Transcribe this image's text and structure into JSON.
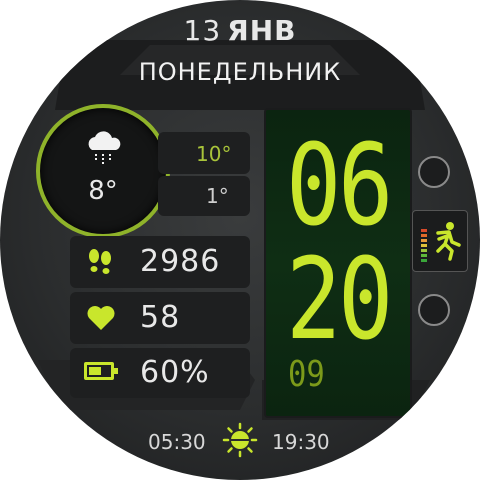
{
  "date": {
    "day": "13",
    "month": "ЯНВ"
  },
  "weekday": "ПОНЕДЕЛЬНИК",
  "weather": {
    "icon": "cloud-rain-icon",
    "temperature": "8°",
    "high": "10°",
    "low": "1°"
  },
  "stats": {
    "steps": "2986",
    "heart_rate": "58",
    "battery": "60%",
    "battery_level": 0.6
  },
  "time": {
    "hours": "06",
    "minutes": "20",
    "seconds": "09"
  },
  "sun": {
    "sunrise": "05:30",
    "sunset": "19:30"
  },
  "colors": {
    "accent": "#c9e62c",
    "accent_dark": "#7c9a1a",
    "panel": "#1e1f20",
    "bezel": "#2b2d2e"
  },
  "icons": {
    "activity": "running-man-icon",
    "steps": "footprints-icon",
    "heart": "heart-icon",
    "battery": "battery-icon",
    "sun": "sun-icon"
  }
}
